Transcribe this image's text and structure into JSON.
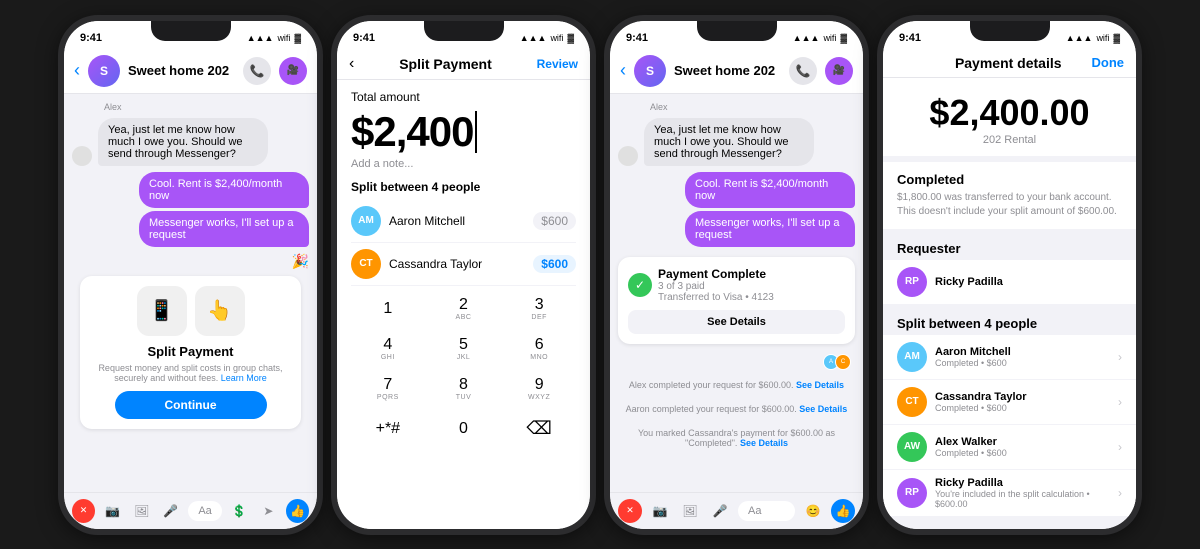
{
  "phone1": {
    "time": "9:41",
    "header": {
      "title": "Sweet home 202",
      "phone_icon": "📞",
      "video_icon": "🎥"
    },
    "chat": {
      "sender": "Alex",
      "received_bubble": "Yea, just let me know how much I owe you. Should we send through Messenger?",
      "sent_bubbles": [
        "Cool. Rent is $2,400/month now",
        "Messenger works, I'll set up a request"
      ],
      "emoji": "🎉"
    },
    "toolbar": {
      "input_placeholder": "Aa"
    },
    "split_card": {
      "title": "Split Payment",
      "description": "Request money and split costs in group chats, securely and without fees.",
      "learn_more": "Learn More",
      "button": "Continue"
    }
  },
  "phone2": {
    "time": "9:41",
    "header": {
      "back": "‹",
      "title": "Split Payment",
      "review": "Review"
    },
    "total_label": "Total amount",
    "amount": "$2,400",
    "note_placeholder": "Add a note...",
    "split_label": "Split between 4 people",
    "people": [
      {
        "name": "Aaron Mitchell",
        "amount": "$600",
        "initials": "AM",
        "active": false
      },
      {
        "name": "Cassandra Taylor",
        "amount": "$600",
        "initials": "CT",
        "active": true
      }
    ],
    "keypad": [
      {
        "main": "1",
        "sub": ""
      },
      {
        "main": "2",
        "sub": "ABC"
      },
      {
        "main": "3",
        "sub": "DEF"
      },
      {
        "main": "4",
        "sub": "GHI"
      },
      {
        "main": "5",
        "sub": "JKL"
      },
      {
        "main": "6",
        "sub": "MNO"
      },
      {
        "main": "7",
        "sub": "PQRS"
      },
      {
        "main": "8",
        "sub": "TUV"
      },
      {
        "main": "9",
        "sub": "WXYZ"
      },
      {
        "main": "+*#",
        "sub": ""
      },
      {
        "main": "0",
        "sub": ""
      },
      {
        "main": "⌫",
        "sub": ""
      }
    ]
  },
  "phone3": {
    "time": "9:41",
    "header": {
      "title": "Sweet home 202"
    },
    "chat": {
      "sender": "Alex",
      "received_bubble": "Yea, just let me know how much I owe you. Should we send through Messenger?",
      "sent_bubbles": [
        "Cool. Rent is $2,400/month now",
        "Messenger works, I'll set up a request"
      ]
    },
    "payment_card": {
      "title": "Payment Complete",
      "subtitle": "3 of 3 paid",
      "transferred": "Transferred to Visa • 4123",
      "button": "See Details"
    },
    "system_messages": [
      "Alex completed your request for $600.00. See Details",
      "Aaron completed your request for $600.00. See Details",
      "You marked Cassandra's payment for $600.00 as \"Completed\". See Details"
    ]
  },
  "phone4": {
    "time": "9:41",
    "header": {
      "title": "Payment details",
      "done": "Done"
    },
    "amount": "$2,400.00",
    "rental_name": "202 Rental",
    "status": "Completed",
    "status_desc": "$1,800.00 was transferred to your bank account. This doesn't include your split amount of $600.00.",
    "requester_label": "Requester",
    "requester": {
      "name": "Ricky Padilla",
      "initials": "RP",
      "color": "#a855f7"
    },
    "split_label": "Split between 4 people",
    "people": [
      {
        "name": "Aaron Mitchell",
        "status": "Completed • $600",
        "initials": "AM",
        "color": "#5ac8fa"
      },
      {
        "name": "Cassandra Taylor",
        "status": "Completed • $600",
        "initials": "CT",
        "color": "#ff9500"
      },
      {
        "name": "Alex Walker",
        "status": "Completed • $600",
        "initials": "AW",
        "color": "#34c759"
      },
      {
        "name": "Ricky Padilla",
        "status": "You're included in the split calculation • $600.00",
        "initials": "RP",
        "color": "#a855f7"
      }
    ]
  }
}
